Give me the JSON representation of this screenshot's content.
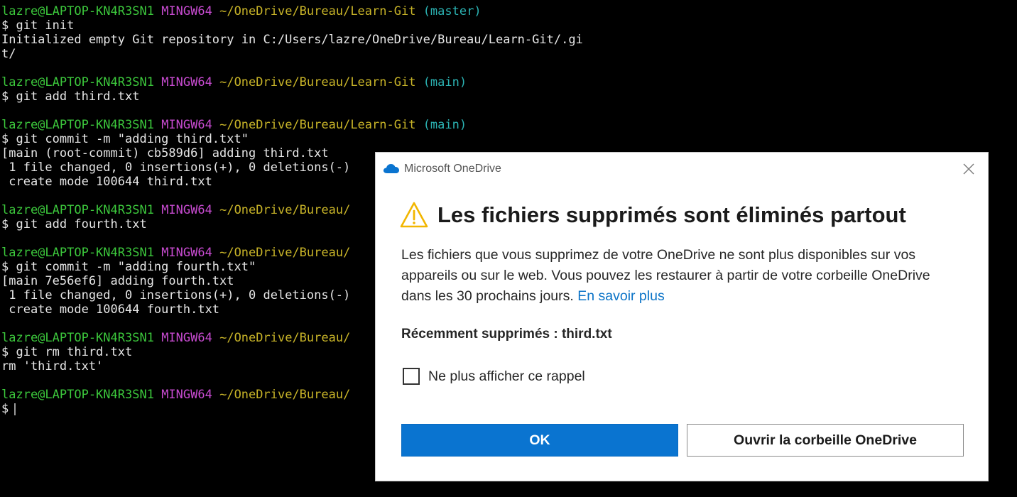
{
  "terminal": {
    "prompt": {
      "user": "lazre@LAPTOP-KN4R3SN1",
      "system": "MINGW64",
      "path": "~/OneDrive/Bureau/Learn-Git",
      "truncated_path": "~/OneDrive/Bureau/"
    },
    "lines": [
      {
        "branch": "(master)"
      },
      {
        "text": "$ git init"
      },
      {
        "text": "Initialized empty Git repository in C:/Users/lazre/OneDrive/Bureau/Learn-Git/.gi"
      },
      {
        "text": "t/"
      },
      {
        "branch": "(main)"
      },
      {
        "text": "$ git add third.txt"
      },
      {
        "branch": "(main)"
      },
      {
        "text": "$ git commit -m \"adding third.txt\""
      },
      {
        "text": "[main (root-commit) cb589d6] adding third.txt"
      },
      {
        "text": " 1 file changed, 0 insertions(+), 0 deletions(-)"
      },
      {
        "text": " create mode 100644 third.txt"
      },
      {
        "text": "$ git add fourth.txt"
      },
      {
        "text": "$ git commit -m \"adding fourth.txt\""
      },
      {
        "text": "[main 7e56ef6] adding fourth.txt"
      },
      {
        "text": " 1 file changed, 0 insertions(+), 0 deletions(-)"
      },
      {
        "text": " create mode 100644 fourth.txt"
      },
      {
        "text": "$ git rm third.txt"
      },
      {
        "text": "rm 'third.txt'"
      },
      {
        "text": "$"
      }
    ]
  },
  "dialog": {
    "app_name": "Microsoft OneDrive",
    "heading": "Les fichiers supprimés sont éliminés partout",
    "body_line1": "Les fichiers que vous supprimez de votre OneDrive ne sont plus disponibles sur vos",
    "body_line2": "appareils ou sur le web. Vous pouvez les restaurer à partir de votre corbeille OneDrive",
    "body_line3": "dans les 30 prochains jours.",
    "link_label": "En savoir plus",
    "recent_label": "Récemment supprimés : third.txt",
    "checkbox_label": "Ne plus afficher ce rappel",
    "checkbox_checked": false,
    "ok_label": "OK",
    "open_bin_label": "Ouvrir la corbeille OneDrive",
    "colors": {
      "primary": "#0a74d0",
      "link": "#0a73c7",
      "warning": "#f2b600"
    }
  }
}
